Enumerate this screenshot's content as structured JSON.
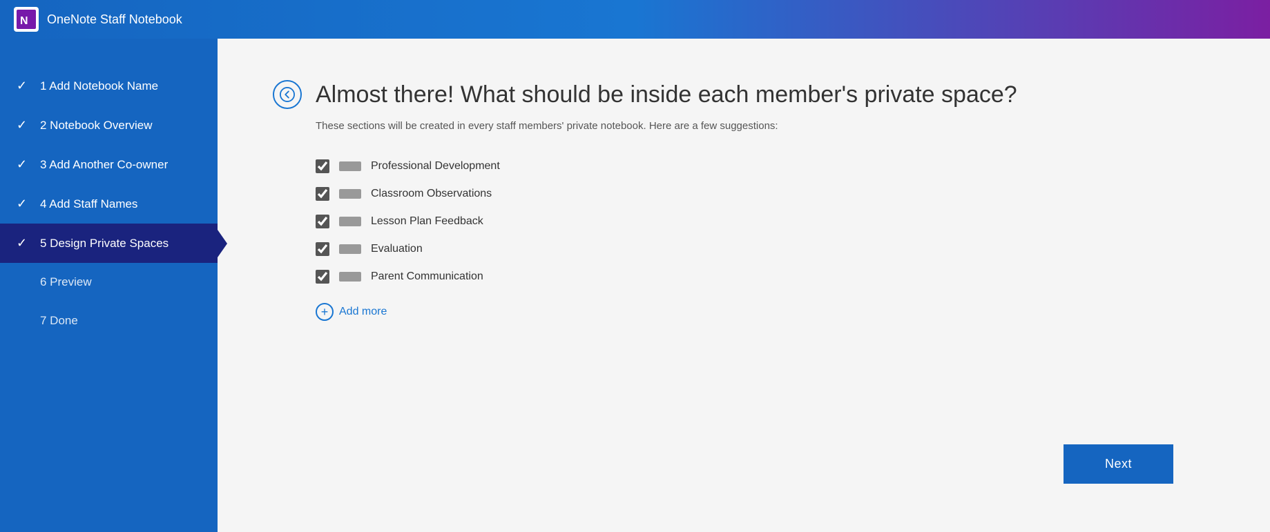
{
  "header": {
    "title": "OneNote Staff Notebook",
    "logo_alt": "OneNote logo"
  },
  "sidebar": {
    "items": [
      {
        "id": "step1",
        "number": "1",
        "label": "Add Notebook Name",
        "completed": true,
        "active": false
      },
      {
        "id": "step2",
        "number": "2",
        "label": "Notebook Overview",
        "completed": true,
        "active": false
      },
      {
        "id": "step3",
        "number": "3",
        "label": "Add Another Co-owner",
        "completed": true,
        "active": false
      },
      {
        "id": "step4",
        "number": "4",
        "label": "Add Staff Names",
        "completed": true,
        "active": false
      },
      {
        "id": "step5",
        "number": "5",
        "label": "Design Private Spaces",
        "completed": true,
        "active": true
      },
      {
        "id": "step6",
        "number": "6",
        "label": "Preview",
        "completed": false,
        "active": false
      },
      {
        "id": "step7",
        "number": "7",
        "label": "Done",
        "completed": false,
        "active": false
      }
    ]
  },
  "content": {
    "back_button_label": "←",
    "title": "Almost there! What should be inside each member's private space?",
    "subtitle": "These sections will be created in every staff members' private notebook. Here are a few suggestions:",
    "sections": [
      {
        "id": "sec1",
        "name": "Professional Development",
        "checked": true
      },
      {
        "id": "sec2",
        "name": "Classroom Observations",
        "checked": true
      },
      {
        "id": "sec3",
        "name": "Lesson Plan Feedback",
        "checked": true
      },
      {
        "id": "sec4",
        "name": "Evaluation",
        "checked": true
      },
      {
        "id": "sec5",
        "name": "Parent Communication",
        "checked": true
      }
    ],
    "add_more_label": "Add more"
  },
  "footer": {
    "next_label": "Next"
  }
}
